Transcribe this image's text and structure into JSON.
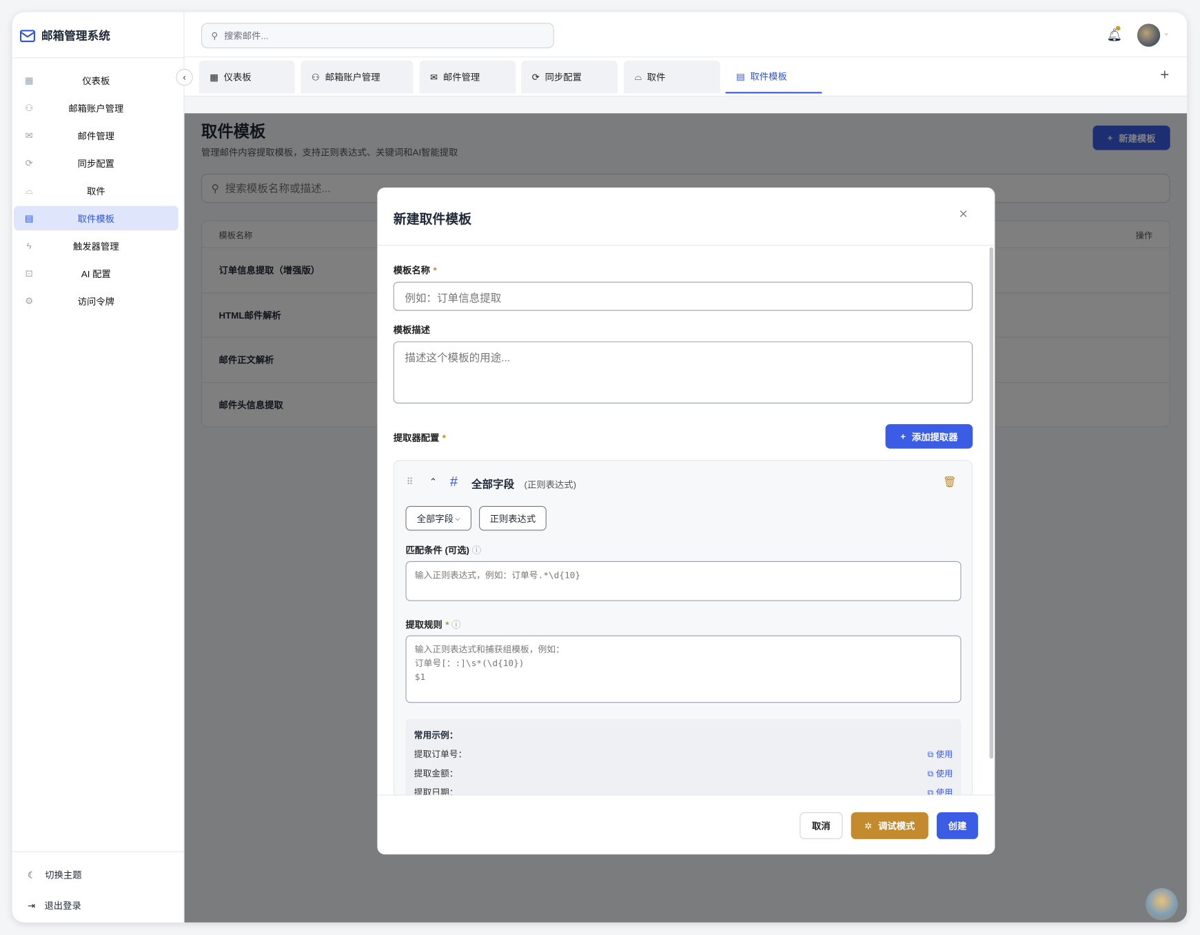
{
  "app": {
    "title": "邮箱管理系统"
  },
  "sidebar": {
    "items": [
      {
        "label": "仪表板",
        "icon": "dashboard-icon"
      },
      {
        "label": "邮箱账户管理",
        "icon": "users-icon"
      },
      {
        "label": "邮件管理",
        "icon": "mail-icon"
      },
      {
        "label": "同步配置",
        "icon": "sync-icon"
      },
      {
        "label": "取件",
        "icon": "inbox-icon"
      },
      {
        "label": "取件模板",
        "icon": "file-icon"
      },
      {
        "label": "触发器管理",
        "icon": "bolt-icon"
      },
      {
        "label": "AI 配置",
        "icon": "bot-icon"
      },
      {
        "label": "访问令牌",
        "icon": "gear-icon"
      }
    ],
    "active": 5,
    "theme_toggle": "切换主题",
    "logout": "退出登录"
  },
  "header": {
    "search_placeholder": "搜索邮件..."
  },
  "tabs": [
    "仪表板",
    "邮箱账户管理",
    "邮件管理",
    "同步配置",
    "取件",
    "取件模板"
  ],
  "page": {
    "title": "取件模板",
    "subtitle": "管理邮件内容提取模板，支持正则表达式、关键词和AI智能提取",
    "new_button": "新建模板",
    "search_placeholder": "搜索模板名称或描述...",
    "table": {
      "col_name": "模板名称",
      "col_actions": "操作",
      "rows": [
        "订单信息提取（增强版）",
        "HTML邮件解析",
        "邮件正文解析",
        "邮件头信息提取"
      ]
    }
  },
  "modal": {
    "title": "新建取件模板",
    "name_label": "模板名称",
    "name_placeholder": "例如：订单信息提取",
    "desc_label": "模板描述",
    "desc_placeholder": "描述这个模板的用途...",
    "extractor_label": "提取器配置",
    "add_extractor": "添加提取器",
    "extractor": {
      "field": "全部字段",
      "type": "(正则表达式)",
      "field_select": "全部字段",
      "type_select": "正则表达式",
      "match_label": "匹配条件 (可选)",
      "match_placeholder": "输入正则表达式，例如：订单号.*\\d{10}",
      "rule_label": "提取规则",
      "rule_placeholder_lines": [
        "输入正则表达式和捕获组模板，例如：",
        "订单号[：:]\\s*(\\d{10})",
        "$1"
      ],
      "examples_title": "常用示例：",
      "examples": [
        "提取订单号：",
        "提取金额：",
        "提取日期："
      ],
      "use_label": "使用"
    },
    "cancel": "取消",
    "debug": "调试模式",
    "create": "创建"
  },
  "colors": {
    "primary": "#3b5ce4",
    "debug": "#c38a2e",
    "required": "#c8881e"
  }
}
